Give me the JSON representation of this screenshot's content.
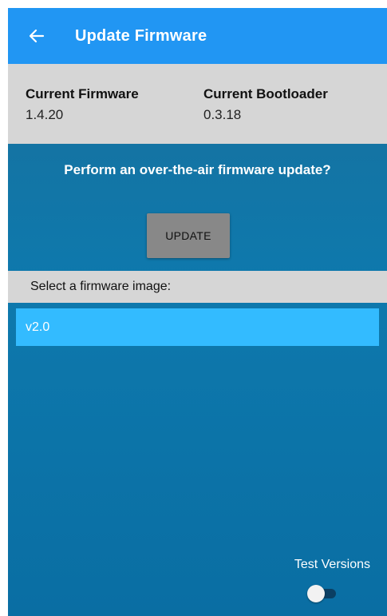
{
  "appbar": {
    "title": "Update Firmware",
    "back_icon": "arrow-left-icon",
    "color": "#2196f3"
  },
  "info": {
    "firmware_label": "Current Firmware",
    "firmware_value": "1.4.20",
    "bootloader_label": "Current Bootloader",
    "bootloader_value": "0.3.18"
  },
  "update": {
    "prompt": "Perform an over-the-air firmware update?",
    "button_label": "UPDATE"
  },
  "images": {
    "header": "Select a firmware image:",
    "items": [
      {
        "label": "v2.0",
        "selected": true
      }
    ],
    "selected_color": "#33bbff"
  },
  "test_versions": {
    "label": "Test Versions",
    "enabled": false
  }
}
